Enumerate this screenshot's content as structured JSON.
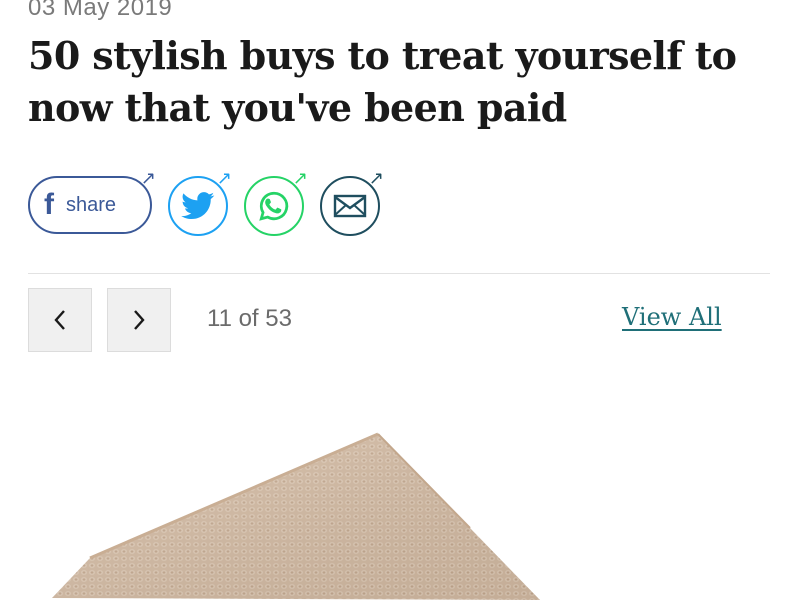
{
  "article": {
    "date": "03 May 2019",
    "headline": "50 stylish buys to treat yourself to now that you've been paid"
  },
  "share": {
    "facebook_label": "share",
    "facebook_icon": "facebook-icon",
    "twitter_icon": "twitter-icon",
    "whatsapp_icon": "whatsapp-icon",
    "email_icon": "email-icon",
    "colors": {
      "facebook": "#3b5998",
      "twitter": "#1da1f2",
      "whatsapp": "#25d366",
      "email": "#1f4e5f"
    }
  },
  "gallery": {
    "counter": "11 of 53",
    "view_all_label": "View All",
    "prev_icon": "chevron-left-icon",
    "next_icon": "chevron-right-icon"
  },
  "image": {
    "icon": "knit-fabric-image",
    "fabric_color": "#d8c0a8"
  }
}
